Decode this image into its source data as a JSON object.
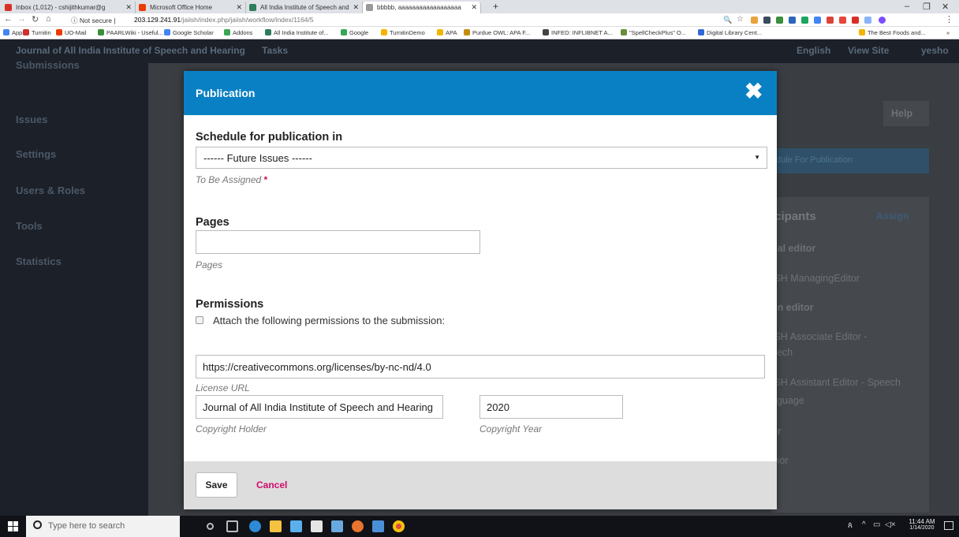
{
  "browser": {
    "tabs": [
      {
        "title": "Inbox (1,012) - cshijithkumar@g",
        "color": "#d93025"
      },
      {
        "title": "Microsoft Office Home",
        "color": "#eb3c00"
      },
      {
        "title": "All India Institute of Speech and",
        "color": "#2e7d5b"
      },
      {
        "title": "bbbbb, aaaaaaaaaaaaaaaaaa",
        "color": "#999999"
      }
    ],
    "new_tab": "+",
    "security": "Not secure",
    "url_host": "203.129.241.91",
    "url_path": "/jaiish/index.php/jaiish/workflow/index/1164/5",
    "bookmarks": [
      {
        "label": "Apps",
        "color": "#4285f4"
      },
      {
        "label": "Turnitin",
        "color": "#d0312d"
      },
      {
        "label": "UO-Mail",
        "color": "#eb3c00"
      },
      {
        "label": "PAARLWiki - Useful...",
        "color": "#3a8f3a"
      },
      {
        "label": "Google Scholar",
        "color": "#4285f4"
      },
      {
        "label": "Addons",
        "color": "#3aa655"
      },
      {
        "label": "All India Institute of...",
        "color": "#2e7d5b"
      },
      {
        "label": "Google",
        "color": "#34a853"
      },
      {
        "label": "TurnitinDemo",
        "color": "#f4b400"
      },
      {
        "label": "APA",
        "color": "#f4b400"
      },
      {
        "label": "Purdue OWL: APA F...",
        "color": "#c28e0e"
      },
      {
        "label": "INFED: INFLIBNET A...",
        "color": "#444444"
      },
      {
        "label": "\"SpellCheckPlus\" O...",
        "color": "#6a8e3a"
      },
      {
        "label": "Digital Library Cent...",
        "color": "#3367d6"
      },
      {
        "label": "The Best Foods and...",
        "color": "#f4b400"
      }
    ],
    "more": "»"
  },
  "site": {
    "journal": "Journal of All India Institute of Speech and Hearing",
    "tasks": "Tasks",
    "language": "English",
    "view_site": "View Site",
    "user": "yesho",
    "help": "Help",
    "schedule_btn": "dule For Publication",
    "participants": "icipants",
    "assign": "Assign",
    "right_rows": [
      "nal editor",
      "ISH ManagingEditor",
      "on editor",
      "ISH Associate Editor -",
      "eech",
      "ISH Assistant Editor - Speech",
      "nguage",
      "or",
      "thor"
    ]
  },
  "sidebar": {
    "items": [
      "Submissions",
      "Issues",
      "Settings",
      "Users & Roles",
      "Tools",
      "Statistics"
    ]
  },
  "modal": {
    "title": "Publication",
    "close": "✖",
    "schedule_heading": "Schedule for publication in",
    "schedule_value": "------ Future Issues ------",
    "schedule_hint": "To Be Assigned",
    "required_mark": "*",
    "pages_heading": "Pages",
    "pages_value": "",
    "pages_hint": "Pages",
    "permissions_heading": "Permissions",
    "permissions_checkbox_label": "Attach the following permissions to the submission:",
    "license_url": "https://creativecommons.org/licenses/by-nc-nd/4.0",
    "license_hint": "License URL",
    "copyright_holder": "Journal of All India Institute of Speech and Hearing",
    "copyright_holder_hint": "Copyright Holder",
    "copyright_year": "2020",
    "copyright_year_hint": "Copyright Year",
    "save": "Save",
    "cancel": "Cancel"
  },
  "taskbar": {
    "search_placeholder": "Type here to search",
    "time": "11:44 AM",
    "date": "1/14/2020"
  },
  "colors": {
    "modal_header": "#0a80c4",
    "cancel": "#d00a6c",
    "required": "#d00f3f"
  }
}
